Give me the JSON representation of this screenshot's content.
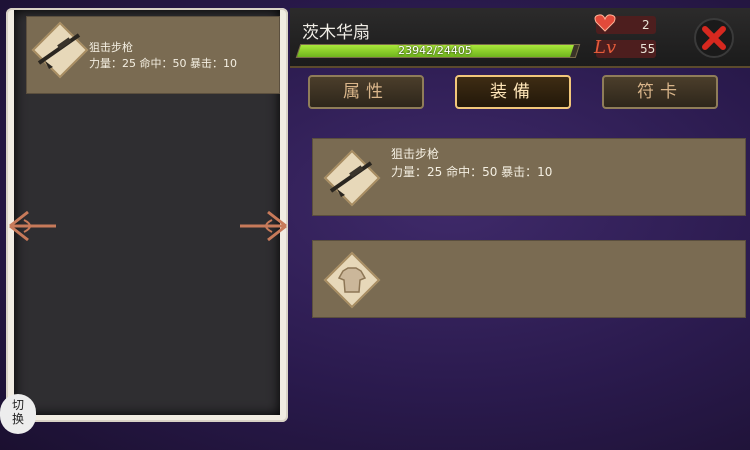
{
  "header": {
    "character_name": "茨木华扇",
    "hp_text": "23942/24405",
    "hp_fraction": 0.981,
    "hearts": "2",
    "level_label": "Lv",
    "level": "55"
  },
  "tabs": [
    {
      "label": "属性",
      "active": false
    },
    {
      "label": "装備",
      "active": true
    },
    {
      "label": "符卡",
      "active": false
    }
  ],
  "left_list": [
    {
      "name": "狙击步枪",
      "stats": "力量：25 命中：50 暴击：10",
      "icon": "rifle-icon"
    }
  ],
  "equipment": [
    {
      "name": "狙击步枪",
      "stats": "力量：25 命中：50 暴击：10",
      "icon": "rifle-icon"
    },
    {
      "name": "",
      "stats": "",
      "icon": "armor-icon"
    }
  ],
  "switch_button": {
    "line1": "切",
    "line2": "换"
  },
  "colors": {
    "hp_fill": "#8fd42a",
    "accent_gold": "#f2c77a",
    "item_bg": "#7a6b52"
  }
}
